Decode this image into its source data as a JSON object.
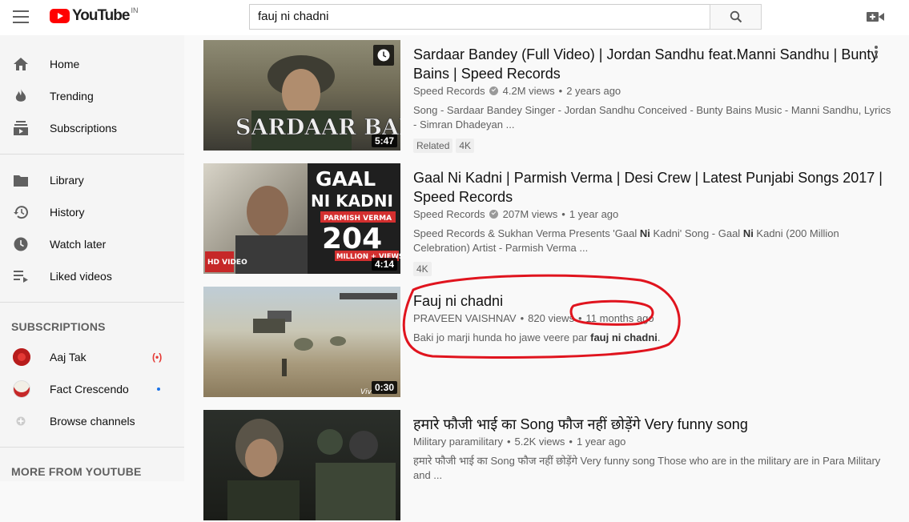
{
  "header": {
    "logo_text": "YouTube",
    "region": "IN",
    "search_value": "fauj ni chadni"
  },
  "sidebar": {
    "primary": [
      {
        "label": "Home",
        "icon": "home-icon"
      },
      {
        "label": "Trending",
        "icon": "trending-icon"
      },
      {
        "label": "Subscriptions",
        "icon": "subscriptions-icon"
      }
    ],
    "library": [
      {
        "label": "Library",
        "icon": "library-icon"
      },
      {
        "label": "History",
        "icon": "history-icon"
      },
      {
        "label": "Watch later",
        "icon": "watch-later-icon"
      },
      {
        "label": "Liked videos",
        "icon": "liked-videos-icon"
      }
    ],
    "subscriptions_title": "SUBSCRIPTIONS",
    "subscriptions": [
      {
        "label": "Aaj Tak",
        "status": "live"
      },
      {
        "label": "Fact Crescendo",
        "status": "new"
      },
      {
        "label": "Browse channels",
        "status": ""
      }
    ],
    "more_title": "MORE FROM YOUTUBE"
  },
  "results": [
    {
      "title": "Sardaar Bandey (Full Video) | Jordan Sandhu feat.Manni Sandhu | Bunty Bains | Speed Records",
      "channel": "Speed Records",
      "verified": true,
      "views": "4.2M views",
      "age": "2 years ago",
      "description": "Song - Sardaar Bandey Singer - Jordan Sandhu Conceived - Bunty Bains Music - Manni Sandhu, Lyrics - Simran Dhadeyan ...",
      "badges": [
        "Related",
        "4K"
      ],
      "duration": "5:47",
      "thumb_text": "SARDAAR BANDEY"
    },
    {
      "title": "Gaal Ni Kadni | Parmish Verma | Desi Crew | Latest Punjabi Songs 2017 | Speed Records",
      "channel": "Speed Records",
      "verified": true,
      "views": "207M views",
      "age": "1 year ago",
      "description_parts": [
        "Speed Records & Sukhan Verma Presents 'Gaal ",
        "Ni",
        " Kadni' Song - Gaal ",
        "Ni",
        " Kadni (200 Million Celebration) Artist - Parmish Verma ..."
      ],
      "badges": [
        "4K"
      ],
      "duration": "4:14",
      "thumb_text": {
        "line1": "GAAL",
        "line2": "NI KADNI",
        "artist": "PARMISH VERMA",
        "count": "204",
        "sub": "MILLION + VIEWS",
        "hd": "HD VIDEO"
      }
    },
    {
      "title": "Fauj ni chadni",
      "channel": "PRAVEEN VAISHNAV",
      "verified": false,
      "views": "820 views",
      "age": "11 months ago",
      "description_parts": [
        "Baki jo marji hunda ho jawe veere par ",
        "fauj ni chadni",
        "."
      ],
      "duration": "0:30",
      "thumb_text": "Viv"
    },
    {
      "title": "हमारे फौजी भाई का Song फौज नहीं छोड़ेंगे Very funny song",
      "channel": "Military paramilitary",
      "verified": false,
      "views": "5.2K views",
      "age": "1 year ago",
      "description": "हमारे फौजी भाई का Song फौज नहीं छोड़ेंगे Very funny song Those who are in the military are in Para Military and ..."
    }
  ],
  "colors": {
    "brand_red": "#ff0000",
    "annotation_red": "#e0141e",
    "sidebar_bg": "#f5f5f5",
    "page_bg": "#f9f9f9"
  }
}
